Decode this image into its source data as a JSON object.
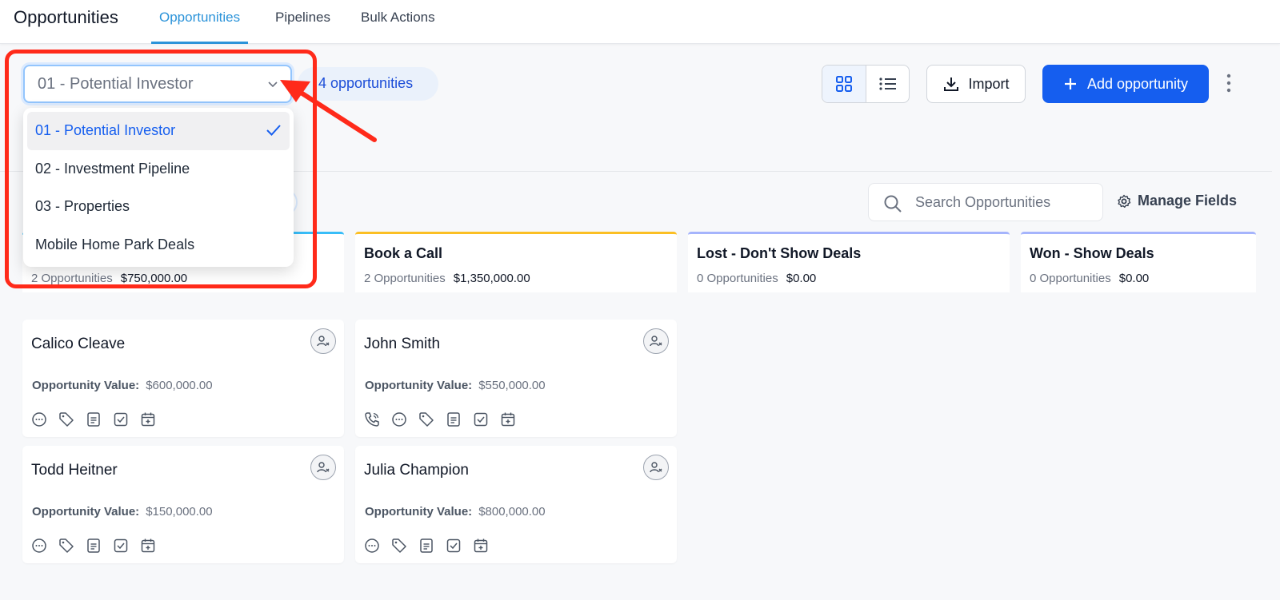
{
  "topnav": {
    "title": "Opportunities",
    "tabs": [
      {
        "label": "Opportunities",
        "active": true
      },
      {
        "label": "Pipelines",
        "active": false
      },
      {
        "label": "Bulk Actions",
        "active": false
      }
    ]
  },
  "toolbar": {
    "pipeline_value": "01 - Potential Investor",
    "opportunity_count": "4 opportunities",
    "import_label": "Import",
    "add_label": "Add opportunity"
  },
  "search": {
    "placeholder": "Search Opportunities",
    "manage_fields_label": "Manage Fields"
  },
  "dropdown": {
    "options": [
      {
        "label": "01 - Potential Investor",
        "selected": true
      },
      {
        "label": "02 - Investment Pipeline",
        "selected": false
      },
      {
        "label": "03 - Properties",
        "selected": false
      },
      {
        "label": "Mobile Home Park Deals",
        "selected": false
      }
    ]
  },
  "stages": [
    {
      "name": "",
      "count": "2 Opportunities",
      "amount": "$750,000.00"
    },
    {
      "name": "Book a Call",
      "count": "2 Opportunities",
      "amount": "$1,350,000.00"
    },
    {
      "name": "Lost - Don't Show Deals",
      "count": "0 Opportunities",
      "amount": "$0.00"
    },
    {
      "name": "Won - Show Deals",
      "count": "0 Opportunities",
      "amount": "$0.00"
    }
  ],
  "cards": [
    {
      "name": "Calico Cleave",
      "value_label": "Opportunity Value:",
      "value": "$600,000.00"
    },
    {
      "name": "John Smith",
      "value_label": "Opportunity Value:",
      "value": "$550,000.00"
    },
    {
      "name": "Todd Heitner",
      "value_label": "Opportunity Value:",
      "value": "$150,000.00"
    },
    {
      "name": "Julia Champion",
      "value_label": "Opportunity Value:",
      "value": "$800,000.00"
    }
  ],
  "colors": {
    "accent_tab": "#2b93d9",
    "primary_button": "#155eef",
    "annotation_red": "#ff2a1a"
  },
  "icons": {
    "card_actions": [
      "chat-icon",
      "tag-icon",
      "note-icon",
      "task-icon",
      "calendar-add-icon"
    ],
    "card_actions_with_call": [
      "phone-icon",
      "chat-icon",
      "tag-icon",
      "note-icon",
      "task-icon",
      "calendar-add-icon"
    ]
  }
}
